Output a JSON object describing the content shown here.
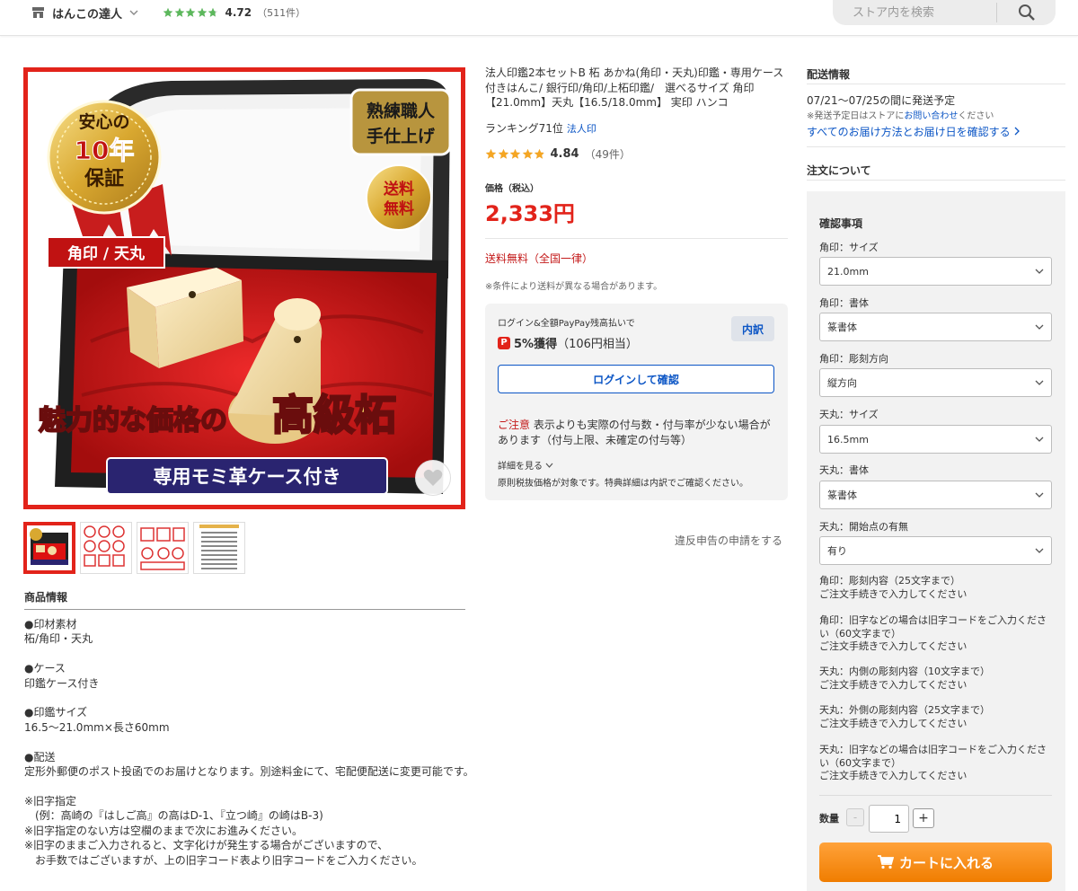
{
  "header": {
    "store_name": "はんこの達人",
    "rating": "4.72",
    "rating_stars": 4.72,
    "review_count": "（511件）",
    "search_placeholder": "ストア内を検索"
  },
  "image": {
    "badge_warranty_line1": "安心の",
    "badge_warranty_line2": "10年",
    "badge_warranty_line3": "保証",
    "badge_craft_line1": "熟練職人",
    "badge_craft_line2": "手仕上げ",
    "badge_free_line1": "送料",
    "badge_free_line2": "無料",
    "tag_shape": "角印 / 天丸",
    "headline_small": "魅力的な価格の",
    "headline_big": "高級柘",
    "banner_case": "専用モミ革ケース付き"
  },
  "product": {
    "title": "法人印鑑2本セットB 柘 あかね(角印・天丸)印鑑・専用ケース付きはんこ/ 銀行印/角印/上柘印鑑/　選べるサイズ 角印【21.0mm】天丸【16.5/18.0mm】 実印 ハンコ",
    "ranking_text": "ランキング71位",
    "ranking_link": "法人印",
    "rating": "4.84",
    "rating_stars": 4.84,
    "review_count": "（49件）",
    "price_label": "価格（税込）",
    "price": "2,333円",
    "shipping_free": "送料無料（全国一律）",
    "shipping_note": "※条件により送料が異なる場合があります。"
  },
  "points": {
    "login_line": "ログイン&全額PayPay残高払いで",
    "pp_icon": "P",
    "earn_bold": "5%獲得",
    "earn_rest": "（106円相当）",
    "breakdown_button": "内訳",
    "login_button": "ログインして確認",
    "caution_label": "ご注意",
    "caution_text": " 表示よりも実際の付与数・付与率が少ない場合があります（付与上限、未確定の付与等）",
    "detail_link": "詳細を見る",
    "note": "原則税抜価格が対象です。特典詳細は内訳でご確認ください。",
    "report_link": "違反申告の申請をする"
  },
  "delivery": {
    "heading": "配送情報",
    "date": "07/21〜07/25の間に発送予定",
    "note_prefix": "※発送予定日はストアに",
    "note_link": "お問い合わせ",
    "note_suffix": "ください",
    "link": "すべてのお届け方法とお届け日を確認する"
  },
  "order": {
    "heading": "注文について",
    "box_heading": "確認事項",
    "options": [
      {
        "label": "角印：サイズ",
        "value": "21.0mm"
      },
      {
        "label": "角印：書体",
        "value": "篆書体"
      },
      {
        "label": "角印：彫刻方向",
        "value": "縦方向"
      },
      {
        "label": "天丸：サイズ",
        "value": "16.5mm"
      },
      {
        "label": "天丸：書体",
        "value": "篆書体"
      },
      {
        "label": "天丸：開始点の有無",
        "value": "有り"
      }
    ],
    "text_options": [
      {
        "label": "角印：彫刻内容（25文字まで）",
        "note": "ご注文手続きで入力してください"
      },
      {
        "label": "角印：旧字などの場合は旧字コードをご入力ください（60文字まで）",
        "note": "ご注文手続きで入力してください"
      },
      {
        "label": "天丸：内側の彫刻内容（10文字まで）",
        "note": "ご注文手続きで入力してください"
      },
      {
        "label": "天丸：外側の彫刻内容（25文字まで）",
        "note": "ご注文手続きで入力してください"
      },
      {
        "label": "天丸：旧字などの場合は旧字コードをご入力ください（60文字まで）",
        "note": "ご注文手続きで入力してください"
      }
    ],
    "quantity_label": "数量",
    "quantity": "1",
    "minus": "-",
    "plus": "+",
    "cart_button": "カートに入れる"
  },
  "product_info": {
    "heading": "商品情報",
    "lines": [
      "●印材素材",
      "柘/角印・天丸",
      "",
      "●ケース",
      "印鑑ケース付き",
      "",
      "●印鑑サイズ",
      "16.5〜21.0mm×長さ60mm",
      "",
      "●配送",
      "定形外郵便のポスト投函でのお届けとなります。別途料金にて、宅配便配送に変更可能です。",
      "",
      "※旧字指定",
      "　(例：高崎の『はしご高』の高はD-1、『立つ崎』の崎はB-3)",
      "※旧字指定のない方は空欄のままで次にお進みください。",
      "※旧字のままご入力されると、文字化けが発生する場合がございますので、",
      "　お手数ではございますが、上の旧字コード表より旧字コードをご入力ください。"
    ]
  },
  "colors": {
    "accent_red": "#e2231a",
    "link_blue": "#0b55c5",
    "cart_orange": "#f59000",
    "star_orange": "#f5a623",
    "star_green": "#5cb85c"
  }
}
